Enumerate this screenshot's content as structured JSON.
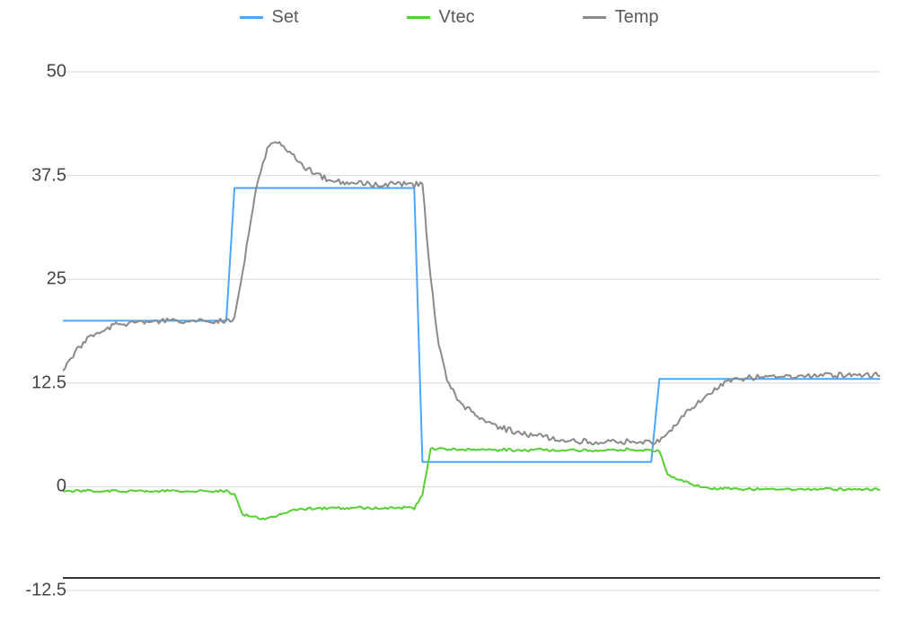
{
  "legend": {
    "set": {
      "label": "Set",
      "color": "#4aa6ff"
    },
    "vtec": {
      "label": "Vtec",
      "color": "#55d033"
    },
    "temp": {
      "label": "Temp",
      "color": "#8a8a8a"
    }
  },
  "yticks": [
    "50",
    "37.5",
    "25",
    "12.5",
    "0",
    "-12.5"
  ],
  "chart_data": {
    "type": "line",
    "xlabel": "",
    "ylabel": "",
    "ylim": [
      -12.5,
      50
    ],
    "xlim": [
      0,
      100
    ],
    "grid": true,
    "legend_position": "top",
    "x": [
      0,
      1,
      2,
      3,
      4,
      5,
      6,
      7,
      8,
      9,
      10,
      11,
      12,
      13,
      14,
      15,
      16,
      17,
      18,
      19,
      20,
      21,
      22,
      23,
      24,
      25,
      26,
      27,
      28,
      29,
      30,
      31,
      32,
      33,
      34,
      35,
      36,
      37,
      38,
      39,
      40,
      41,
      42,
      43,
      44,
      45,
      46,
      47,
      48,
      49,
      50,
      51,
      52,
      53,
      54,
      55,
      56,
      57,
      58,
      59,
      60,
      61,
      62,
      63,
      64,
      65,
      66,
      67,
      68,
      69,
      70,
      71,
      72,
      73,
      74,
      75,
      76,
      77,
      78,
      79,
      80,
      81,
      82,
      83,
      84,
      85,
      86,
      87,
      88,
      89,
      90,
      91,
      92,
      93,
      94,
      95,
      96,
      97,
      98,
      99,
      100
    ],
    "series": [
      {
        "name": "Set",
        "color": "#4aa6ff",
        "values": [
          20,
          20,
          20,
          20,
          20,
          20,
          20,
          20,
          20,
          20,
          20,
          20,
          20,
          20,
          20,
          20,
          20,
          20,
          20,
          20,
          20,
          36,
          36,
          36,
          36,
          36,
          36,
          36,
          36,
          36,
          36,
          36,
          36,
          36,
          36,
          36,
          36,
          36,
          36,
          36,
          36,
          36,
          36,
          36,
          3,
          3,
          3,
          3,
          3,
          3,
          3,
          3,
          3,
          3,
          3,
          3,
          3,
          3,
          3,
          3,
          3,
          3,
          3,
          3,
          3,
          3,
          3,
          3,
          3,
          3,
          3,
          3,
          3,
          13,
          13,
          13,
          13,
          13,
          13,
          13,
          13,
          13,
          13,
          13,
          13,
          13,
          13,
          13,
          13,
          13,
          13,
          13,
          13,
          13,
          13,
          13,
          13,
          13,
          13,
          13,
          13
        ]
      },
      {
        "name": "Vtec",
        "color": "#55d033",
        "values": [
          -0.5,
          -0.5,
          -0.5,
          -0.5,
          -0.6,
          -0.5,
          -0.5,
          -0.6,
          -0.5,
          -0.5,
          -0.5,
          -0.6,
          -0.5,
          -0.5,
          -0.5,
          -0.5,
          -0.6,
          -0.5,
          -0.5,
          -0.5,
          -0.5,
          -0.9,
          -3.3,
          -3.6,
          -3.8,
          -3.9,
          -3.6,
          -3.2,
          -2.9,
          -2.7,
          -2.6,
          -2.6,
          -2.6,
          -2.5,
          -2.6,
          -2.6,
          -2.5,
          -2.6,
          -2.6,
          -2.5,
          -2.6,
          -2.6,
          -2.5,
          -2.6,
          -1.0,
          4.5,
          4.6,
          4.5,
          4.5,
          4.5,
          4.4,
          4.5,
          4.5,
          4.4,
          4.5,
          4.4,
          4.4,
          4.4,
          4.5,
          4.4,
          4.4,
          4.4,
          4.5,
          4.4,
          4.4,
          4.4,
          4.4,
          4.4,
          4.4,
          4.5,
          4.4,
          4.4,
          4.4,
          4.3,
          1.5,
          1.0,
          0.6,
          0.3,
          0.1,
          -0.1,
          -0.2,
          -0.2,
          -0.3,
          -0.3,
          -0.3,
          -0.3,
          -0.3,
          -0.3,
          -0.3,
          -0.3,
          -0.3,
          -0.3,
          -0.3,
          -0.3,
          -0.3,
          -0.3,
          -0.3,
          -0.3,
          -0.3,
          -0.3,
          -0.3
        ]
      },
      {
        "name": "Temp",
        "color": "#8a8a8a",
        "values": [
          14.0,
          15.6,
          16.8,
          17.7,
          18.4,
          18.9,
          19.3,
          19.6,
          19.7,
          19.8,
          19.9,
          19.9,
          20.0,
          20.0,
          20.0,
          20.0,
          20.0,
          20.0,
          20.0,
          20.0,
          20.0,
          20.3,
          26.0,
          32.0,
          37.5,
          40.5,
          41.6,
          41.0,
          40.0,
          39.0,
          38.3,
          37.8,
          37.2,
          36.8,
          36.7,
          36.6,
          36.5,
          36.5,
          36.4,
          36.5,
          36.4,
          36.5,
          36.4,
          36.4,
          36.5,
          25.0,
          17.0,
          13.0,
          11.0,
          9.8,
          9.0,
          8.3,
          7.8,
          7.4,
          7.0,
          6.7,
          6.5,
          6.3,
          6.1,
          6.0,
          5.8,
          5.7,
          5.6,
          5.5,
          5.5,
          5.4,
          5.4,
          5.4,
          5.4,
          5.4,
          5.4,
          5.4,
          5.4,
          5.5,
          6.5,
          7.5,
          8.5,
          9.5,
          10.5,
          11.3,
          12.0,
          12.5,
          12.8,
          13.0,
          13.1,
          13.2,
          13.2,
          13.3,
          13.3,
          13.3,
          13.3,
          13.4,
          13.4,
          13.4,
          13.4,
          13.5,
          13.5,
          13.5,
          13.5,
          13.5,
          13.5
        ]
      }
    ]
  }
}
